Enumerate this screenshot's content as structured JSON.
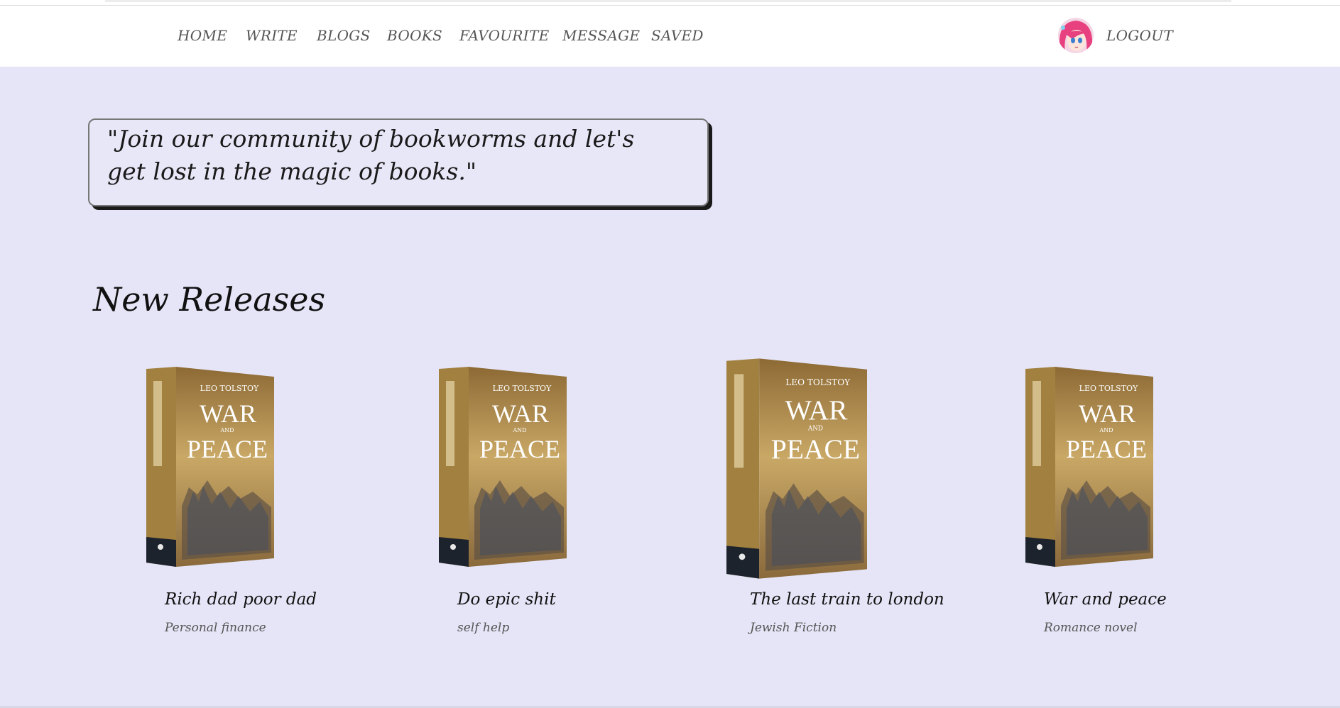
{
  "nav": {
    "items": [
      {
        "label": "HOME"
      },
      {
        "label": "WRITE"
      },
      {
        "label": "BLOGS"
      },
      {
        "label": "BOOKS"
      },
      {
        "label": "FAVOURITE"
      },
      {
        "label": "MESSAGE"
      },
      {
        "label": "SAVED"
      }
    ],
    "logout_label": "LOGOUT"
  },
  "hero": {
    "quote": "\"Join our community of bookworms and let's get lost in the magic of books.\""
  },
  "new_releases": {
    "title": "New Releases",
    "books": [
      {
        "title": "Rich dad poor dad",
        "genre": "Personal finance",
        "cover_author": "LEO TOLSTOY",
        "cover_title_1": "WAR",
        "cover_and": "AND",
        "cover_title_2": "PEACE"
      },
      {
        "title": "Do epic shit",
        "genre": "self help",
        "cover_author": "LEO TOLSTOY",
        "cover_title_1": "WAR",
        "cover_and": "AND",
        "cover_title_2": "PEACE"
      },
      {
        "title": "The last train to london",
        "genre": "Jewish Fiction",
        "cover_author": "LEO TOLSTOY",
        "cover_title_1": "WAR",
        "cover_and": "AND",
        "cover_title_2": "PEACE"
      },
      {
        "title": "War and peace",
        "genre": "Romance novel",
        "cover_author": "LEO TOLSTOY",
        "cover_title_1": "WAR",
        "cover_and": "AND",
        "cover_title_2": "PEACE"
      }
    ]
  },
  "colors": {
    "background": "#e5e5f7",
    "navbar": "#ffffff",
    "nav_text": "#555555",
    "cover_gold": "#b8904e"
  }
}
